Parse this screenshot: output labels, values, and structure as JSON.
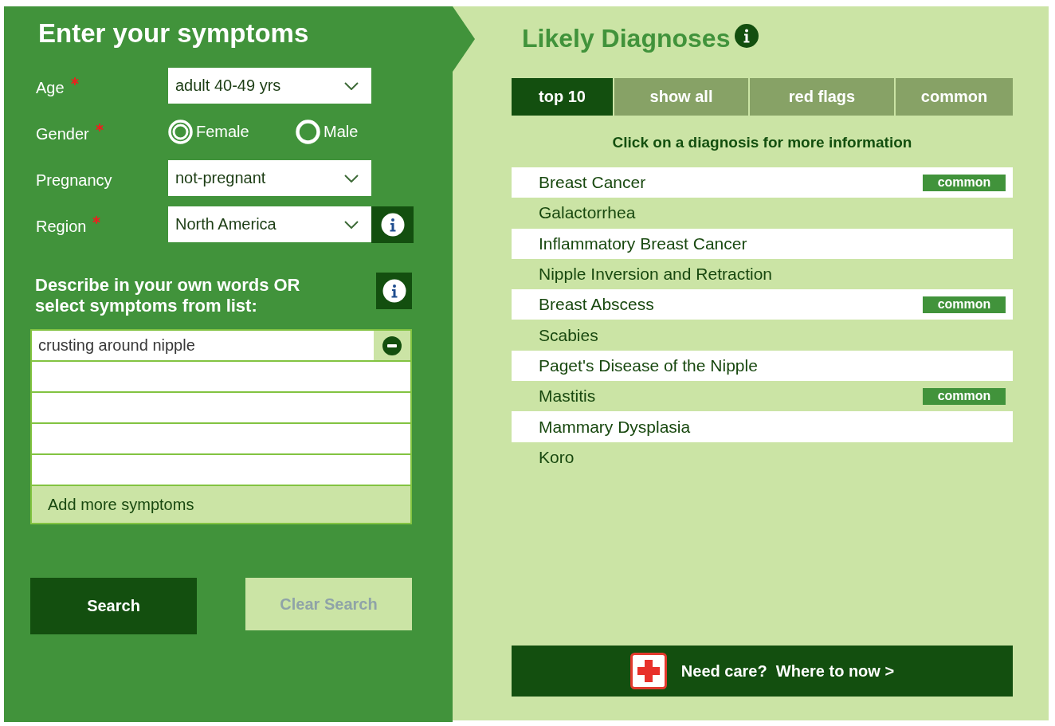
{
  "symptom_form": {
    "title": "Enter your symptoms",
    "fields": [
      {
        "kind": "select",
        "label": "Age",
        "required": true,
        "value": "adult 40-49 yrs",
        "info": false
      },
      {
        "kind": "radio",
        "label": "Gender",
        "required": true,
        "options": [
          {
            "label": "Female",
            "selected": true
          },
          {
            "label": "Male",
            "selected": false
          }
        ]
      },
      {
        "kind": "select",
        "label": "Pregnancy",
        "required": false,
        "value": "not-pregnant",
        "info": false
      },
      {
        "kind": "select",
        "label": "Region",
        "required": true,
        "value": "North America",
        "info": true
      }
    ],
    "describe": {
      "label": "Describe in your own words OR select symptoms from list:",
      "info": true
    },
    "symptoms": [
      {
        "kind": "filled",
        "value": "crusting around nipple"
      },
      {
        "kind": "empty"
      },
      {
        "kind": "empty"
      },
      {
        "kind": "empty"
      },
      {
        "kind": "empty"
      }
    ],
    "add_more": "Add more symptoms",
    "buttons": [
      {
        "label": "Search",
        "disabled": false
      },
      {
        "label": "Clear Search",
        "disabled": true
      }
    ]
  },
  "diagnoses": {
    "title": "Likely Diagnoses",
    "info": true,
    "tabs": [
      {
        "label": "top 10",
        "selected": true
      },
      {
        "label": "show all",
        "selected": false
      },
      {
        "label": "red flags",
        "selected": false
      },
      {
        "label": "common",
        "selected": false
      }
    ],
    "hint": "Click on a diagnosis for more information",
    "items": [
      {
        "name": "Breast Cancer",
        "tag": "common"
      },
      {
        "name": "Galactorrhea"
      },
      {
        "name": "Inflammatory Breast Cancer"
      },
      {
        "name": "Nipple Inversion and Retraction"
      },
      {
        "name": "Breast Abscess",
        "tag": "common"
      },
      {
        "name": "Scabies"
      },
      {
        "name": "Paget's Disease of the Nipple"
      },
      {
        "name": "Mastitis",
        "tag": "common"
      },
      {
        "name": "Mammary Dysplasia"
      },
      {
        "name": "Koro"
      }
    ],
    "care_button": "Need care?  Where to now >"
  }
}
